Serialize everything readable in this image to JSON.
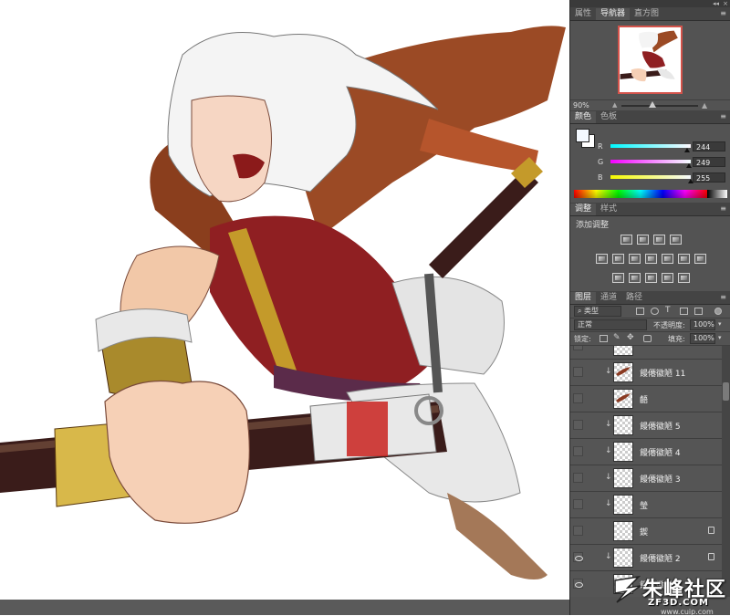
{
  "top_strip": {
    "collapse": "◂◂",
    "close": "×"
  },
  "navigator": {
    "tabs": [
      "属性",
      "导航器",
      "直方图"
    ],
    "active_tab": "导航器",
    "zoom": "90%"
  },
  "color": {
    "tabs": [
      "颜色",
      "色板"
    ],
    "active_tab": "颜色",
    "foreground": "#f4f9ff",
    "background": "#ffffff",
    "channels": [
      {
        "label": "R",
        "value": "244",
        "fraction": 0.957
      },
      {
        "label": "G",
        "value": "249",
        "fraction": 0.976
      },
      {
        "label": "B",
        "value": "255",
        "fraction": 1.0
      }
    ]
  },
  "adjustments": {
    "tabs": [
      "调整",
      "样式"
    ],
    "active_tab": "调整",
    "title": "添加调整",
    "icons": [
      [
        "brightness-icon",
        "levels-icon",
        "curves-icon",
        "exposure-icon"
      ],
      [
        "vibrance-icon",
        "hue-saturation-icon",
        "color-balance-icon",
        "black-white-icon",
        "photo-filter-icon",
        "channel-mixer-icon",
        "color-lookup-icon"
      ],
      [
        "invert-icon",
        "posterize-icon",
        "threshold-icon",
        "gradient-map-icon",
        "selective-color-icon"
      ]
    ]
  },
  "layers": {
    "tabs": [
      "图层",
      "通道",
      "路径"
    ],
    "active_tab": "图层",
    "filter_kind": "类型",
    "blend_mode": "正常",
    "opacity_label": "不透明度:",
    "opacity": "100%",
    "lock_label": "锁定:",
    "fill_label": "填充:",
    "fill": "100%",
    "items": [
      {
        "name": "",
        "visible": false,
        "clipped": false,
        "locked": false,
        "kind": "partial"
      },
      {
        "name": "饅僊徽陋 11",
        "visible": false,
        "clipped": true,
        "locked": false,
        "kind": "brush"
      },
      {
        "name": "齬",
        "visible": false,
        "clipped": false,
        "locked": false,
        "kind": "brush"
      },
      {
        "name": "饅僊徽陋 5",
        "visible": false,
        "clipped": true,
        "locked": false,
        "kind": "empty"
      },
      {
        "name": "饅僊徽陋 4",
        "visible": false,
        "clipped": true,
        "locked": false,
        "kind": "empty"
      },
      {
        "name": "饅僊徽陋 3",
        "visible": false,
        "clipped": true,
        "locked": false,
        "kind": "empty"
      },
      {
        "name": "瑩",
        "visible": false,
        "clipped": true,
        "locked": false,
        "kind": "empty"
      },
      {
        "name": "鍥",
        "visible": false,
        "clipped": false,
        "locked": true,
        "kind": "empty"
      },
      {
        "name": "饅僊徽陋 2",
        "visible": true,
        "clipped": true,
        "locked": true,
        "kind": "empty"
      },
      {
        "name": "饅僊徽陋 1",
        "visible": true,
        "clipped": false,
        "locked": false,
        "kind": "empty"
      }
    ]
  },
  "watermark": {
    "brand": "朱峰社区",
    "domain": "ZF3D.COM",
    "url": "www.cuip.com"
  }
}
